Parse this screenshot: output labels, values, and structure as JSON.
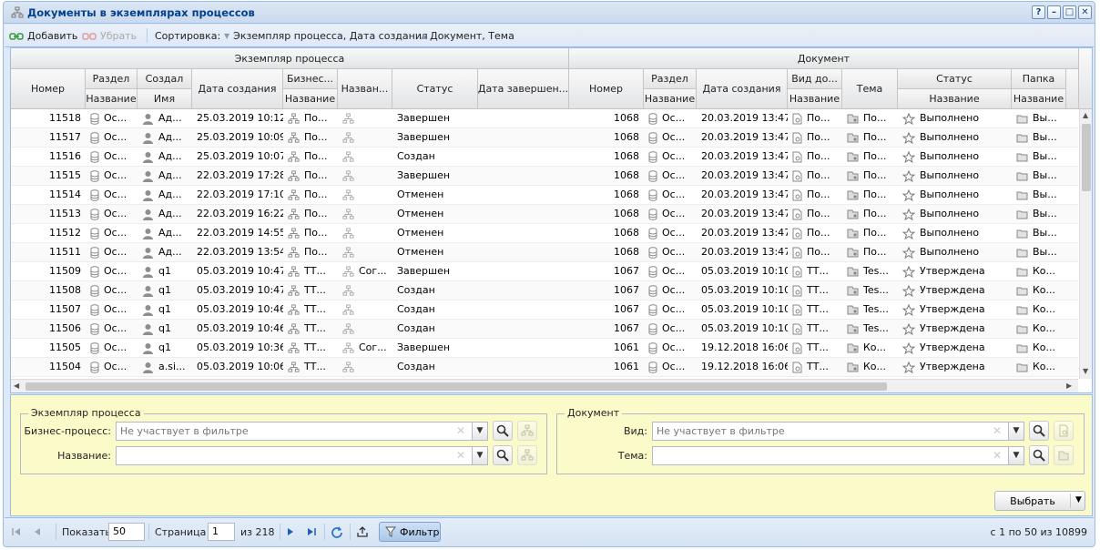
{
  "window": {
    "title": "Документы в экземплярах процессов",
    "buttons": [
      "?",
      "–",
      "□",
      "✕"
    ]
  },
  "toolbar": {
    "add_label": "Добавить",
    "remove_label": "Убрать",
    "sort_label": "Сортировка:",
    "sort1": "Экземпляр процесса, Дата создания",
    "sort2": "Документ, Тема"
  },
  "grid": {
    "group_instance": "Экземпляр процесса",
    "group_document": "Документ",
    "headers": {
      "number": "Номер",
      "section": "Раздел",
      "section_name": "Название",
      "creator": "Создал",
      "creator_name": "Имя",
      "created": "Дата создания",
      "bp": "Бизнес...",
      "bp_name": "Название",
      "name": "Назван...",
      "status": "Статус",
      "finished": "Дата завершен...",
      "doc_number": "Номер",
      "doc_section": "Раздел",
      "doc_section_name": "Название",
      "doc_created": "Дата создания",
      "doc_kind": "Вид до...",
      "doc_kind_name": "Название",
      "topic": "Тема",
      "doc_status": "Статус",
      "doc_status_name": "Название",
      "folder": "Папка",
      "folder_name": "Название"
    },
    "rows": [
      {
        "num": "11518",
        "sec": "Ос...",
        "creator": "Ад...",
        "created": "25.03.2019 10:12",
        "bp": "По...",
        "name": "",
        "status": "Завершен",
        "doc_num": "1068",
        "doc_sec": "Ос...",
        "doc_created": "20.03.2019 13:47",
        "kind": "По...",
        "topic": "По...",
        "doc_status": "Выполнено",
        "folder": "Вы..."
      },
      {
        "num": "11517",
        "sec": "Ос...",
        "creator": "Ад...",
        "created": "25.03.2019 10:09",
        "bp": "По...",
        "name": "",
        "status": "Завершен",
        "doc_num": "1068",
        "doc_sec": "Ос...",
        "doc_created": "20.03.2019 13:47",
        "kind": "По...",
        "topic": "По...",
        "doc_status": "Выполнено",
        "folder": "Вы..."
      },
      {
        "num": "11516",
        "sec": "Ос...",
        "creator": "Ад...",
        "created": "25.03.2019 10:07",
        "bp": "По...",
        "name": "",
        "status": "Создан",
        "doc_num": "1068",
        "doc_sec": "Ос...",
        "doc_created": "20.03.2019 13:47",
        "kind": "По...",
        "topic": "По...",
        "doc_status": "Выполнено",
        "folder": "Вы..."
      },
      {
        "num": "11515",
        "sec": "Ос...",
        "creator": "Ад...",
        "created": "22.03.2019 17:28",
        "bp": "По...",
        "name": "",
        "status": "Завершен",
        "doc_num": "1068",
        "doc_sec": "Ос...",
        "doc_created": "20.03.2019 13:47",
        "kind": "По...",
        "topic": "По...",
        "doc_status": "Выполнено",
        "folder": "Вы..."
      },
      {
        "num": "11514",
        "sec": "Ос...",
        "creator": "Ад...",
        "created": "22.03.2019 17:10",
        "bp": "По...",
        "name": "",
        "status": "Отменен",
        "doc_num": "1068",
        "doc_sec": "Ос...",
        "doc_created": "20.03.2019 13:47",
        "kind": "По...",
        "topic": "По...",
        "doc_status": "Выполнено",
        "folder": "Вы..."
      },
      {
        "num": "11513",
        "sec": "Ос...",
        "creator": "Ад...",
        "created": "22.03.2019 16:22",
        "bp": "По...",
        "name": "",
        "status": "Отменен",
        "doc_num": "1068",
        "doc_sec": "Ос...",
        "doc_created": "20.03.2019 13:47",
        "kind": "По...",
        "topic": "По...",
        "doc_status": "Выполнено",
        "folder": "Вы..."
      },
      {
        "num": "11512",
        "sec": "Ос...",
        "creator": "Ад...",
        "created": "22.03.2019 14:55",
        "bp": "По...",
        "name": "",
        "status": "Отменен",
        "doc_num": "1068",
        "doc_sec": "Ос...",
        "doc_created": "20.03.2019 13:47",
        "kind": "По...",
        "topic": "По...",
        "doc_status": "Выполнено",
        "folder": "Вы..."
      },
      {
        "num": "11511",
        "sec": "Ос...",
        "creator": "Ад...",
        "created": "22.03.2019 13:54",
        "bp": "По...",
        "name": "",
        "status": "Отменен",
        "doc_num": "1068",
        "doc_sec": "Ос...",
        "doc_created": "20.03.2019 13:47",
        "kind": "По...",
        "topic": "По...",
        "doc_status": "Выполнено",
        "folder": "Вы..."
      },
      {
        "num": "11509",
        "sec": "Ос...",
        "creator": "q1",
        "created": "05.03.2019 10:47",
        "bp": "ТТ...",
        "name": "Сог...",
        "status": "Завершен",
        "doc_num": "1067",
        "doc_sec": "Ос...",
        "doc_created": "05.03.2019 10:10",
        "kind": "ТТ...",
        "topic": "Tes...",
        "doc_status": "Утверждена",
        "folder": "Ко..."
      },
      {
        "num": "11508",
        "sec": "Ос...",
        "creator": "q1",
        "created": "05.03.2019 10:47",
        "bp": "ТТ...",
        "name": "",
        "status": "Создан",
        "doc_num": "1067",
        "doc_sec": "Ос...",
        "doc_created": "05.03.2019 10:10",
        "kind": "ТТ...",
        "topic": "Tes...",
        "doc_status": "Утверждена",
        "folder": "Ко..."
      },
      {
        "num": "11507",
        "sec": "Ос...",
        "creator": "q1",
        "created": "05.03.2019 10:46",
        "bp": "ТТ...",
        "name": "",
        "status": "Создан",
        "doc_num": "1067",
        "doc_sec": "Ос...",
        "doc_created": "05.03.2019 10:10",
        "kind": "ТТ...",
        "topic": "Tes...",
        "doc_status": "Утверждена",
        "folder": "Ко..."
      },
      {
        "num": "11506",
        "sec": "Ос...",
        "creator": "q1",
        "created": "05.03.2019 10:46",
        "bp": "ТТ...",
        "name": "",
        "status": "Создан",
        "doc_num": "1067",
        "doc_sec": "Ос...",
        "doc_created": "05.03.2019 10:10",
        "kind": "ТТ...",
        "topic": "Tes...",
        "doc_status": "Утверждена",
        "folder": "Ко..."
      },
      {
        "num": "11505",
        "sec": "Ос...",
        "creator": "q1",
        "created": "05.03.2019 10:36",
        "bp": "ТТ...",
        "name": "Сог...",
        "status": "Завершен",
        "doc_num": "1061",
        "doc_sec": "Ос...",
        "doc_created": "19.12.2018 16:06",
        "kind": "ТТ...",
        "topic": "Ко...",
        "doc_status": "Утверждена",
        "folder": "Ко..."
      },
      {
        "num": "11504",
        "sec": "Ос...",
        "creator": "a.si...",
        "created": "05.03.2019 10:06",
        "bp": "ТТ...",
        "name": "",
        "status": "Создан",
        "doc_num": "1061",
        "doc_sec": "Ос...",
        "doc_created": "19.12.2018 16:06",
        "kind": "ТТ...",
        "topic": "Ко...",
        "doc_status": "Утверждена",
        "folder": "Ко..."
      }
    ]
  },
  "filter": {
    "instance_legend": "Экземпляр процесса",
    "bp_label": "Бизнес-процесс:",
    "bp_value": "Не участвует в фильтре",
    "name_label": "Название:",
    "name_value": "",
    "doc_legend": "Документ",
    "kind_label": "Вид:",
    "kind_value": "Не участвует в фильтре",
    "topic_label": "Тема:",
    "topic_value": "",
    "select_button": "Выбрать"
  },
  "pager": {
    "show_label": "Показать",
    "page_size": "50",
    "page_label": "Страница",
    "page": "1",
    "of_pages": "из 218",
    "filter_label": "Фильтр",
    "summary": "с 1 по 50 из 10899"
  }
}
